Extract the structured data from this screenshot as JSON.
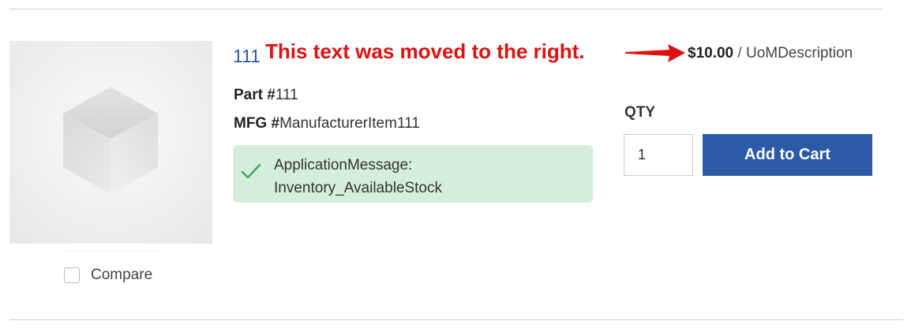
{
  "product": {
    "name": "111",
    "price_amount": "$10.00",
    "price_separator": " / ",
    "price_uom": "UoMDescription",
    "part_label": "Part #",
    "part_value": "111",
    "mfg_label": "MFG #",
    "mfg_value": "ManufacturerItem111",
    "image_icon": "box-placeholder-icon"
  },
  "annotation": {
    "text": "This text was moved to the right.",
    "color": "#e01010"
  },
  "inventory": {
    "line1": "ApplicationMessage:",
    "line2": "Inventory_AvailableStock",
    "icon": "checkmark-icon",
    "background": "#d5eedc"
  },
  "cart": {
    "qty_label": "QTY",
    "qty_value": "1",
    "add_label": "Add to Cart",
    "accent": "#2a5aa8"
  },
  "compare": {
    "label": "Compare",
    "checked": false
  }
}
